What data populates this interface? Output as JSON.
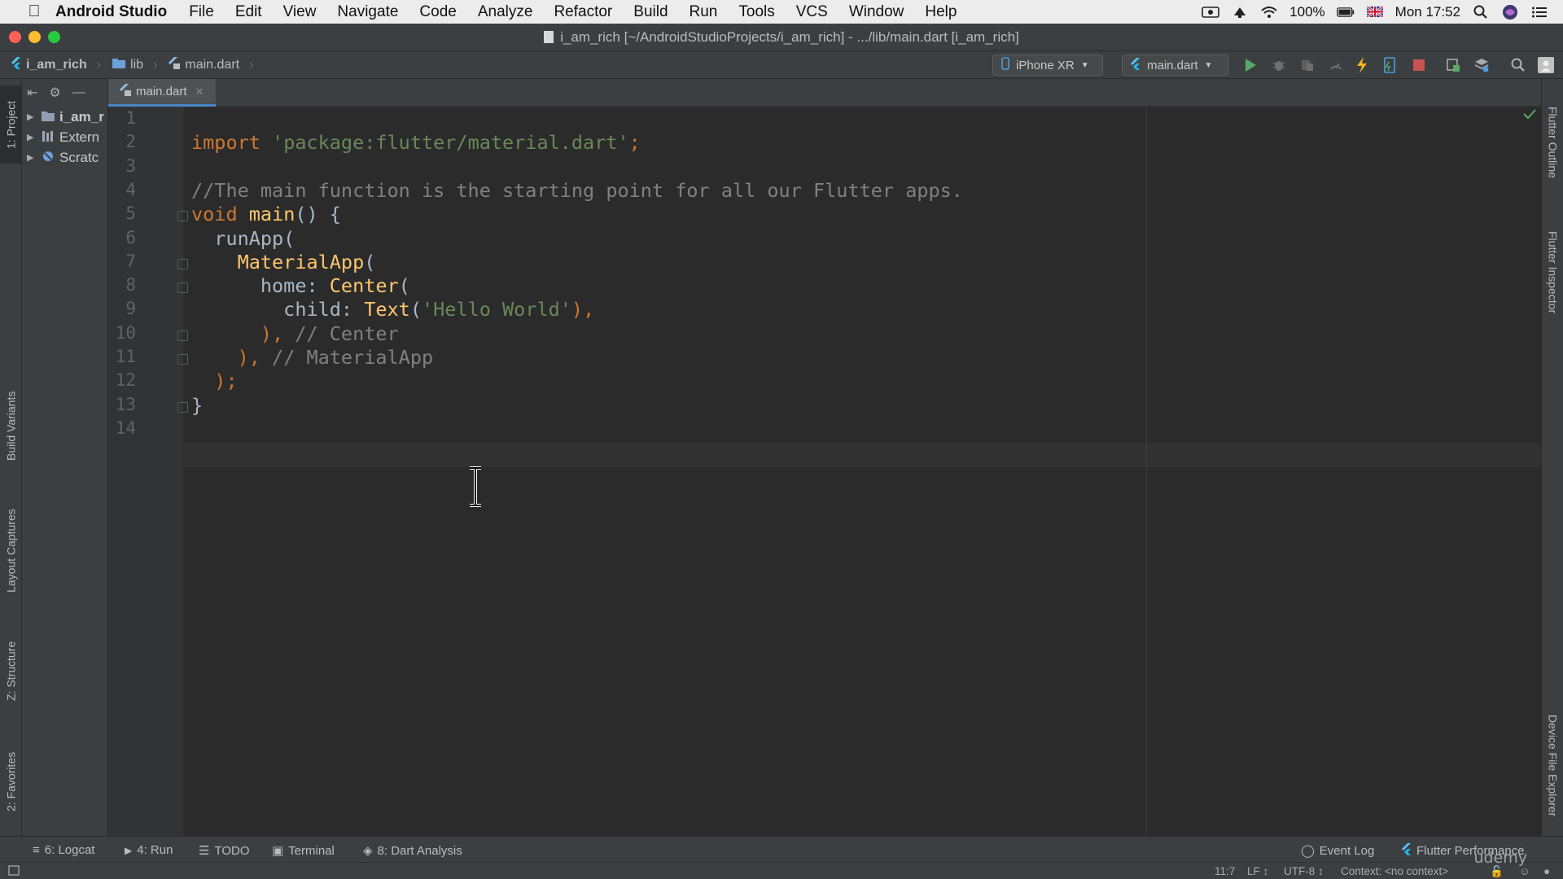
{
  "os_menu": {
    "app_name": "Android Studio",
    "items": [
      "File",
      "Edit",
      "View",
      "Navigate",
      "Code",
      "Analyze",
      "Refactor",
      "Build",
      "Run",
      "Tools",
      "VCS",
      "Window",
      "Help"
    ],
    "battery": "100%",
    "clock": "Mon 17:52"
  },
  "window": {
    "title": "i_am_rich [~/AndroidStudioProjects/i_am_rich] - .../lib/main.dart [i_am_rich]"
  },
  "breadcrumb": [
    "i_am_rich",
    "lib",
    "main.dart"
  ],
  "toolbar": {
    "device": "iPhone XR",
    "run_config": "main.dart"
  },
  "project_tree": [
    "i_am_r",
    "Extern",
    "Scratc"
  ],
  "left_tools": [
    "1: Project",
    "Build Variants",
    "Layout Captures",
    "Z: Structure",
    "2: Favorites"
  ],
  "right_tools": [
    "Flutter Outline",
    "Flutter Inspector",
    "Device File Explorer"
  ],
  "editor": {
    "tab": "main.dart",
    "line_numbers": [
      "1",
      "2",
      "3",
      "4",
      "5",
      "6",
      "7",
      "8",
      "9",
      "10",
      "11",
      "12",
      "13",
      "14"
    ],
    "lines": [
      [],
      [
        {
          "t": "import ",
          "c": "kw"
        },
        {
          "t": "'package:flutter/material.dart'",
          "c": "str"
        },
        {
          "t": ";",
          "c": "kw"
        }
      ],
      [],
      [
        {
          "t": "//The main function is the starting point for all our Flutter apps.",
          "c": "cm"
        }
      ],
      [
        {
          "t": "void ",
          "c": "kw"
        },
        {
          "t": "main",
          "c": "cls"
        },
        {
          "t": "() {",
          "c": ""
        }
      ],
      [
        {
          "t": "  runApp(",
          "c": ""
        }
      ],
      [
        {
          "t": "    ",
          "c": ""
        },
        {
          "t": "MaterialApp",
          "c": "cls"
        },
        {
          "t": "(",
          "c": ""
        }
      ],
      [
        {
          "t": "      home: ",
          "c": ""
        },
        {
          "t": "Center",
          "c": "cls"
        },
        {
          "t": "(",
          "c": ""
        }
      ],
      [
        {
          "t": "        child: ",
          "c": ""
        },
        {
          "t": "Text",
          "c": "cls"
        },
        {
          "t": "(",
          "c": ""
        },
        {
          "t": "'Hello World'",
          "c": "str"
        },
        {
          "t": "),",
          "c": "kw"
        }
      ],
      [
        {
          "t": "      ), ",
          "c": "kw"
        },
        {
          "t": "// Center",
          "c": "cm"
        }
      ],
      [
        {
          "t": "    ), ",
          "c": "kw"
        },
        {
          "t": "// MaterialApp",
          "c": "cm"
        }
      ],
      [
        {
          "t": "  );",
          "c": "kw"
        }
      ],
      [
        {
          "t": "}",
          "c": ""
        }
      ],
      []
    ]
  },
  "bottom_tools": {
    "logcat": "6: Logcat",
    "run": "4: Run",
    "todo": "TODO",
    "terminal": "Terminal",
    "dart_analysis": "8: Dart Analysis",
    "event_log": "Event Log",
    "flutter_performance": "Flutter Performance"
  },
  "status": {
    "position": "11:7",
    "line_sep": "LF ↕",
    "encoding": "UTF-8 ↕",
    "context": "Context: <no context>"
  },
  "watermark": "udemy"
}
